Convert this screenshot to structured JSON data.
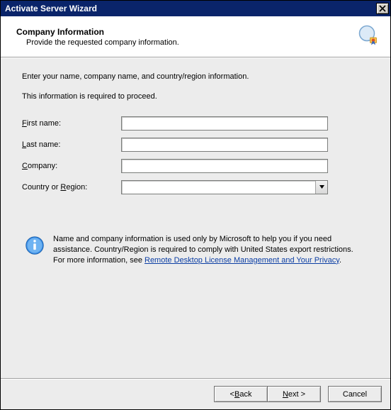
{
  "window": {
    "title": "Activate Server Wizard"
  },
  "header": {
    "title": "Company Information",
    "subtitle": "Provide the requested company information."
  },
  "content": {
    "intro": "Enter your name, company name, and country/region information.",
    "required": "This information is required to proceed.",
    "labels": {
      "first_name_pre": "F",
      "first_name_rest": "irst name:",
      "last_name_pre": "L",
      "last_name_rest": "ast name:",
      "company_pre": "C",
      "company_rest": "ompany:",
      "country_pre": "Country or ",
      "country_u": "R",
      "country_rest": "egion:"
    },
    "values": {
      "first_name": "",
      "last_name": "",
      "company": "",
      "country": ""
    }
  },
  "info": {
    "line1": "Name and company information is used only by Microsoft to help you if you need assistance. Country/Region is required to comply with United States export restrictions. For more information, see ",
    "link": "Remote Desktop License Management and Your Privacy",
    "after": "."
  },
  "buttons": {
    "back_lt": "< ",
    "back_u": "B",
    "back_rest": "ack",
    "next_u": "N",
    "next_rest": "ext >",
    "cancel": "Cancel"
  }
}
